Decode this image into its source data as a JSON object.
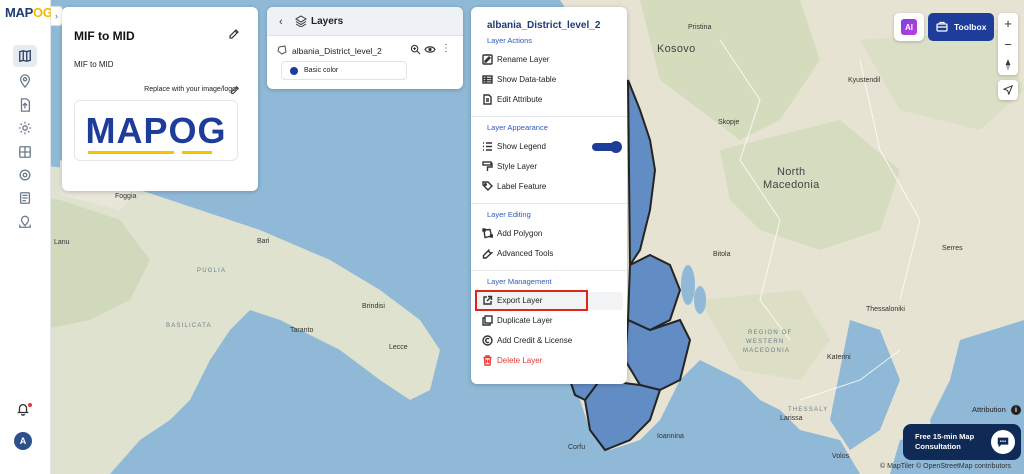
{
  "app": {
    "logo_text_main": "MAP",
    "logo_text_accent": "OG"
  },
  "info_panel": {
    "title": "MIF to MID",
    "description": "MIF to MID",
    "replace_text": "Replace with your image/logo",
    "logo_text_main": "MAP",
    "logo_text_accent": "OG"
  },
  "layers_panel": {
    "title": "Layers",
    "layer_name": "albania_District_level_2",
    "style_label": "Basic color",
    "style_color": "#1e3c9a"
  },
  "layer_menu": {
    "layer_name": "albania_District_level_2",
    "sections": {
      "actions": "Layer Actions",
      "appearance": "Layer Appearance",
      "editing": "Layer Editing",
      "management": "Layer Management"
    },
    "items": {
      "rename": "Rename Layer",
      "datatable": "Show Data-table",
      "edit_attribute": "Edit Attribute",
      "show_legend": "Show Legend",
      "style_layer": "Style Layer",
      "label_feature": "Label Feature",
      "add_polygon": "Add Polygon",
      "advanced_tools": "Advanced Tools",
      "export_layer": "Export Layer",
      "duplicate_layer": "Duplicate Layer",
      "add_credit": "Add Credit & License",
      "delete_layer": "Delete Layer"
    },
    "show_legend_on": true
  },
  "toolbar": {
    "ai_label": "AI",
    "toolbox_label": "Toolbox",
    "zoom_in": "+",
    "zoom_out": "−"
  },
  "avatar_initial": "A",
  "attribution": "Attribution",
  "attribution_info": "i",
  "consult": "Free 15-min Map Consultation",
  "map_credits": "© MapTiler © OpenStreetMap contributors",
  "map_labels": {
    "pristina": "Pristina",
    "kosovo": "Kosovo",
    "kyustendil": "Kyustendil",
    "skopje": "Skopje",
    "north_macedonia_1": "North",
    "north_macedonia_2": "Macedonia",
    "bitola": "Bitola",
    "serres": "Serres",
    "thessaloniki": "Thessaloniki",
    "western_macedonia_1": "WESTERN",
    "western_macedonia_2": "MACEDONIA",
    "region_of": "REGION OF",
    "katerini": "Katerini",
    "larissa": "Larissa",
    "thessaly": "THESSALY",
    "ioannina": "Ioannina",
    "corfu": "Corfu",
    "volos": "Volos",
    "foggia": "Foggia",
    "puglia": "PUGLIA",
    "bari": "Bari",
    "brindisi": "Brindisi",
    "basilicata": "BASILICATA",
    "taranto": "Taranto",
    "lecce": "Lecce",
    "lanu": "Lanu"
  },
  "colors": {
    "brand_blue": "#1e3c9a",
    "brand_yellow": "#f5c400",
    "sea": "#8fb9d6",
    "land": "#e8e6d9",
    "district_fill": "#5b88c4",
    "danger": "#e53935",
    "highlight_box": "#e0251b"
  }
}
